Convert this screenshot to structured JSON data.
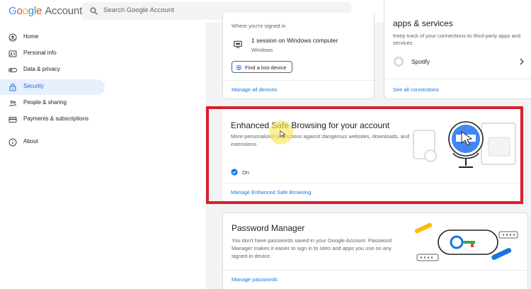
{
  "header": {
    "logo_letters": [
      "G",
      "o",
      "o",
      "g",
      "l",
      "e"
    ],
    "logo_suffix": "Account",
    "search_placeholder": "Search Google Account"
  },
  "sidebar": {
    "items": [
      {
        "label": "Home",
        "icon": "home-person-icon"
      },
      {
        "label": "Personal info",
        "icon": "id-card-icon"
      },
      {
        "label": "Data & privacy",
        "icon": "toggle-icon"
      },
      {
        "label": "Security",
        "icon": "lock-icon",
        "active": true
      },
      {
        "label": "People & sharing",
        "icon": "people-icon"
      },
      {
        "label": "Payments & subscriptions",
        "icon": "credit-card-icon"
      },
      {
        "label": "About",
        "icon": "info-icon"
      }
    ]
  },
  "devices_card": {
    "subtitle": "Where you're signed in",
    "session_text": "1 session on Windows computer",
    "session_os": "Windows",
    "find_device_label": "Find a lost device",
    "manage_link": "Manage all devices"
  },
  "apps_card": {
    "title": "apps & services",
    "description": "Keep track of your connections to third-party apps and services",
    "app_name": "Spotify",
    "see_all_link": "See all connections"
  },
  "safe_browsing_card": {
    "title": "Enhanced Safe Browsing for your account",
    "description": "More personalized protections against dangerous websites, downloads, and extensions.",
    "status": "On",
    "manage_link": "Manage Enhanced Safe Browsing"
  },
  "password_card": {
    "title": "Password Manager",
    "description": "You don't have passwords saved in your Google Account. Password Manager makes it easier to sign in to sites and apps you use on any signed-in device.",
    "manage_link": "Manage passwords"
  },
  "colors": {
    "accent": "#1a73e8",
    "active_bg": "#e8f0fe",
    "highlight_border": "#d91f2b"
  }
}
